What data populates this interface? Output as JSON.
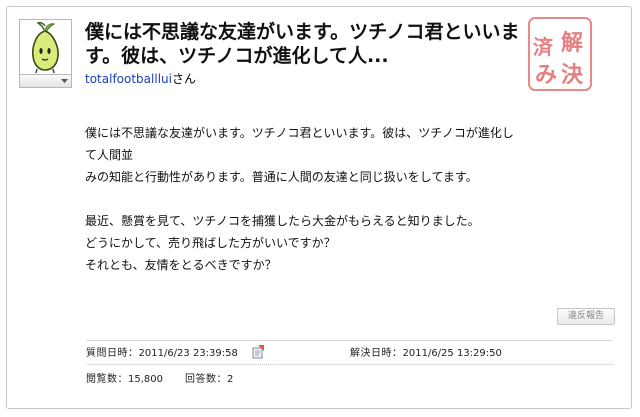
{
  "question": {
    "title": "僕には不思議な友達がいます。ツチノコ君といいます。彼は、ツチノコが進化して人...",
    "asker": "totalfootballlui",
    "asker_suffix": "さん",
    "body": [
      "僕には不思議な友達がいます。ツチノコ君といいます。彼は、ツチノコが進化して人間並",
      "みの知能と行動性があります。普通に人間の友達と同じ扱いをしてます。",
      "",
      "最近、懸賞を見て、ツチノコを捕獲したら大金がもらえると知りました。",
      "どうにかして、売り飛ばした方がいいですか？",
      "それとも、友情をとるべきですか？"
    ],
    "stamp": [
      "解",
      "済",
      "み",
      "決"
    ]
  },
  "actions": {
    "report_label": "違反報告"
  },
  "meta": {
    "asked_label": "質問日時：",
    "asked_value": "2011/6/23 23:39:58",
    "resolved_label": "解決日時：",
    "resolved_value": "2011/6/25 13:29:50",
    "views_label": "閲覧数：",
    "views_value": "15,800",
    "answers_label": "回答数：",
    "answers_value": "2"
  },
  "colors": {
    "stamp_red": "#e06060",
    "link_blue": "#1a3fb8"
  },
  "icons": {
    "avatar": "green-sprout-character",
    "feed": "feed-icon",
    "dropdown": "triangle-down-icon"
  }
}
